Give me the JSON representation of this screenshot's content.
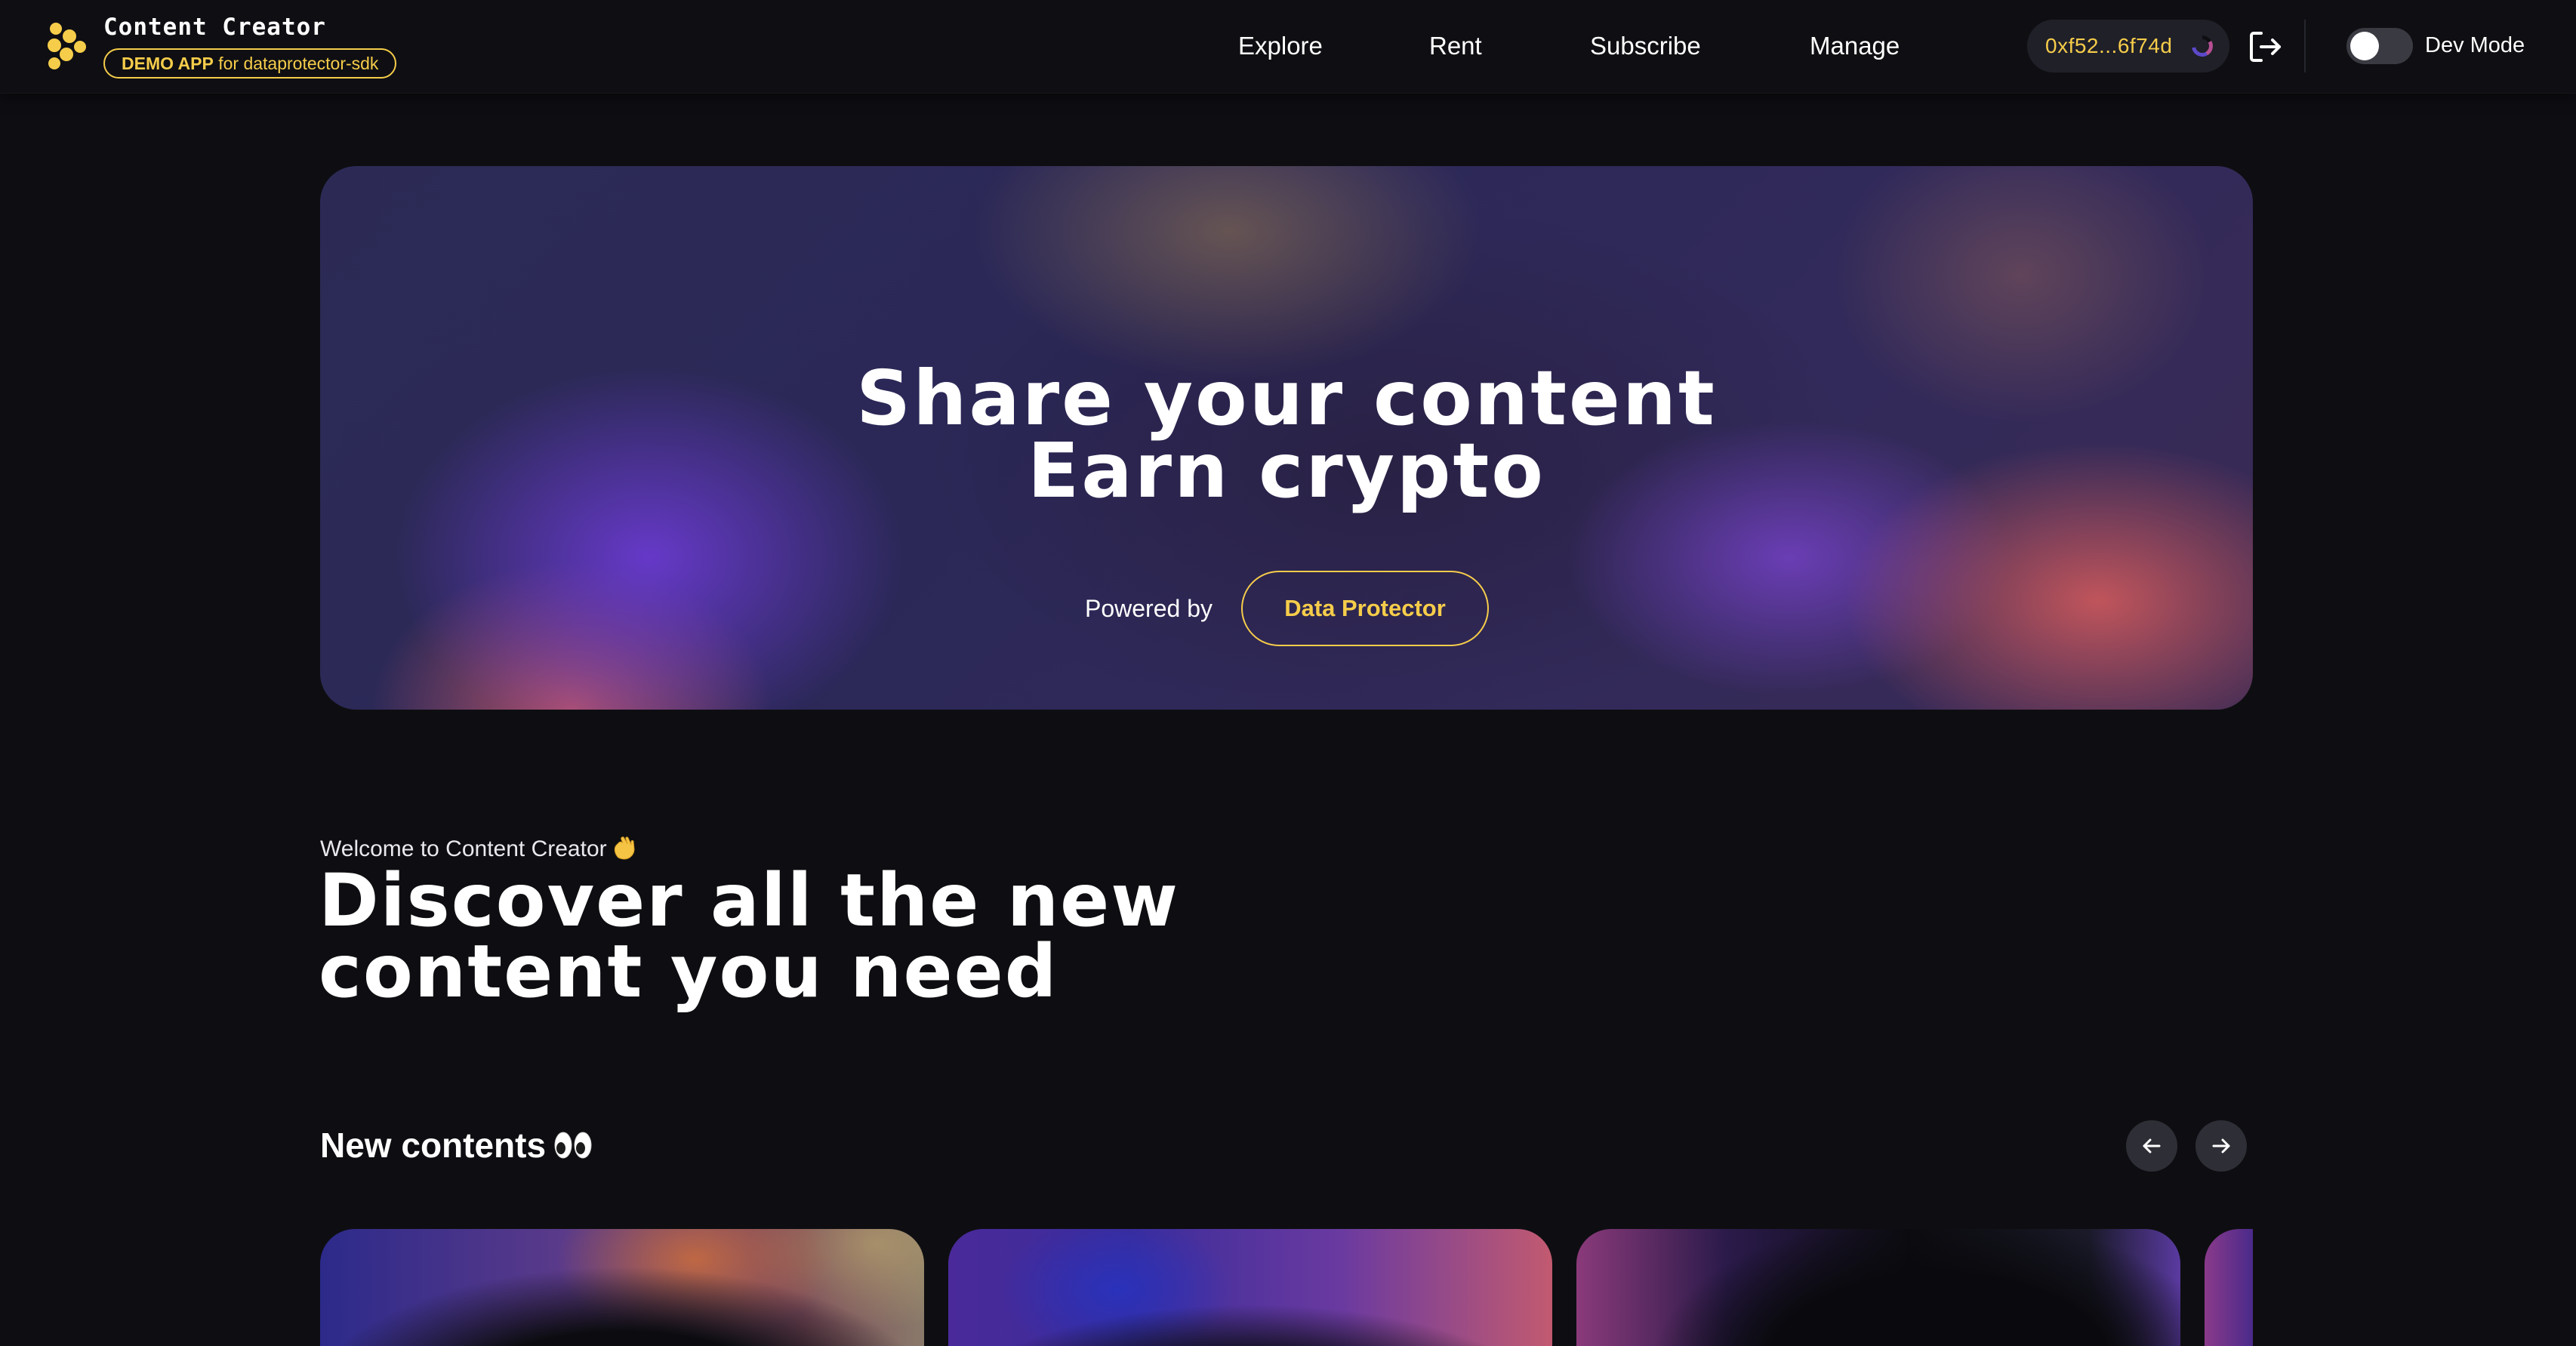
{
  "header": {
    "app_name": "Content Creator",
    "badge_strong": "DEMO APP",
    "badge_rest": " for dataprotector-sdk",
    "logo_icon": "honeycomb-logo-icon"
  },
  "nav": {
    "items": [
      {
        "label": "Explore"
      },
      {
        "label": "Rent"
      },
      {
        "label": "Subscribe"
      },
      {
        "label": "Manage"
      }
    ]
  },
  "wallet": {
    "address": "0xf52...6f74d",
    "avatar_icon": "wallet-avatar-icon"
  },
  "logout_icon": "logout-icon",
  "dev_mode": {
    "label": "Dev Mode",
    "enabled": false
  },
  "hero": {
    "title_line1": "Share your content",
    "title_line2": "Earn crypto",
    "powered_by": "Powered by",
    "button_label": "Data Protector"
  },
  "discover": {
    "welcome": "Welcome to Content Creator",
    "welcome_emoji": "waving-hand-icon",
    "heading_line1": "Discover all the new",
    "heading_line2": "content you need"
  },
  "new_contents": {
    "title": "New contents",
    "title_emoji": "eyes-icon",
    "prev_icon": "arrow-left-icon",
    "next_icon": "arrow-right-icon"
  },
  "colors": {
    "background": "#0e0e12",
    "accent": "#f6cd4a",
    "wallet_bg": "#202029",
    "text": "#ffffff"
  }
}
